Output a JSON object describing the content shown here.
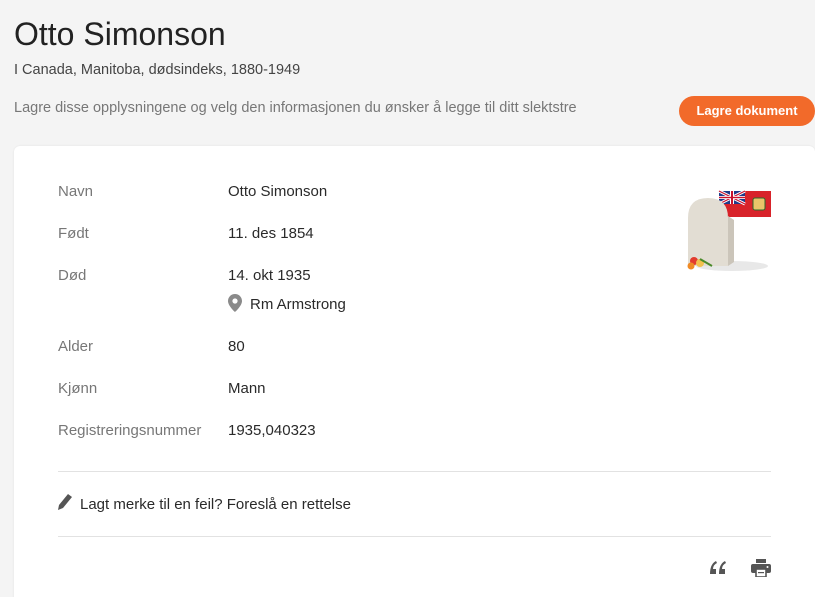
{
  "header": {
    "name": "Otto Simonson",
    "collection": "I Canada, Manitoba, dødsindeks, 1880-1949",
    "save_prompt": "Lagre disse opplysningene og velg den informasjonen du ønsker å legge til ditt slektstre",
    "save_button_label": "Lagre dokument"
  },
  "record": {
    "fields": [
      {
        "label": "Navn",
        "value": "Otto Simonson"
      },
      {
        "label": "Født",
        "value": "11. des 1854"
      },
      {
        "label": "Død",
        "value": "14. okt 1935"
      },
      {
        "label": "Alder",
        "value": "80"
      },
      {
        "label": "Kjønn",
        "value": "Mann"
      },
      {
        "label": "Registreringsnummer",
        "value": "1935,040323"
      }
    ],
    "death_place": "Rm Armstrong",
    "icons": {
      "place": "map-pin-icon",
      "image": "headstone-with-flag-icon"
    }
  },
  "feedback": {
    "suggest_label": "Lagt merke til en feil? Foreslå en rettelse",
    "icon": "pencil-icon"
  },
  "tools": {
    "quote_icon": "quote-icon",
    "print_icon": "print-icon"
  },
  "colors": {
    "accent": "#f26a2a",
    "background": "#f4f4f4",
    "card": "#ffffff",
    "label": "#777777",
    "icon": "#555555"
  }
}
